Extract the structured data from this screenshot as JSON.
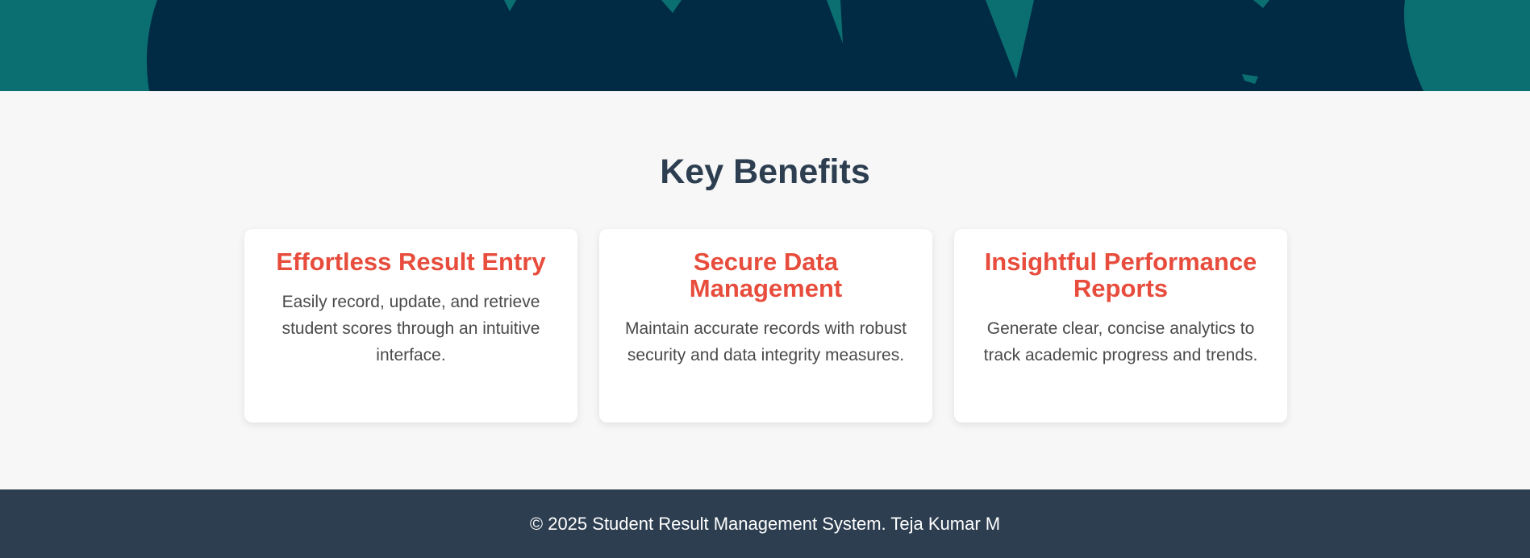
{
  "hero": {
    "background_color": "#0b6f71",
    "silhouette_color": "#012b45"
  },
  "benefits": {
    "title": "Key Benefits",
    "cards": [
      {
        "title": "Effortless Result Entry",
        "text": "Easily record, update, and retrieve student scores through an intuitive interface."
      },
      {
        "title": "Secure Data Management",
        "text": "Maintain accurate records with robust security and data integrity measures."
      },
      {
        "title": "Insightful Performance Reports",
        "text": "Generate clear, concise analytics to track academic progress and trends."
      }
    ]
  },
  "footer": {
    "text": "© 2025 Student Result Management System. Teja Kumar M"
  },
  "colors": {
    "title": "#2c3e50",
    "accent": "#e74c3c",
    "body_text": "#4a4a4a",
    "footer_bg": "#2d3e50"
  }
}
